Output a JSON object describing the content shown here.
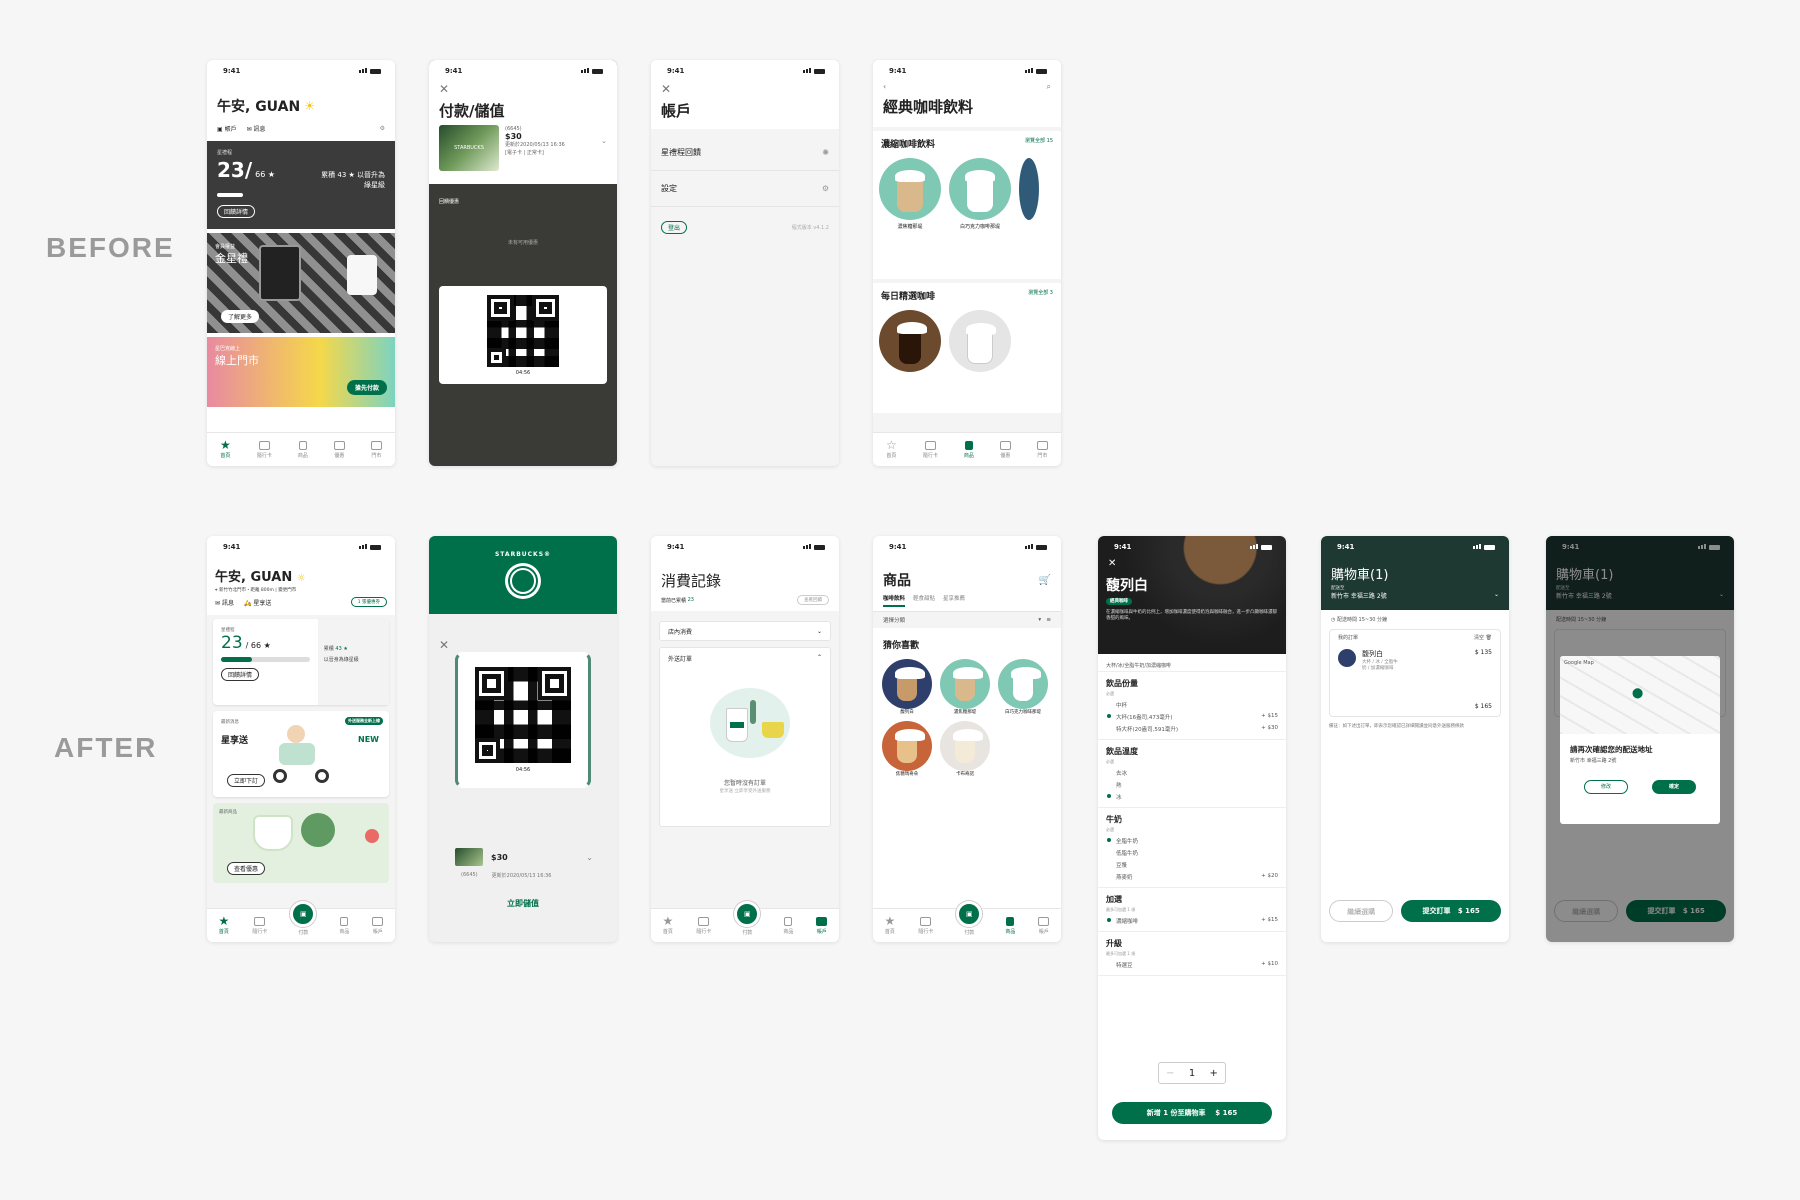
{
  "labels": {
    "before": "BEFORE",
    "after": "AFTER"
  },
  "status_time": "9:41",
  "before": {
    "home": {
      "greeting": "午安, GUAN",
      "links": [
        "帳戶",
        "訊息"
      ],
      "card_label": "星禮程",
      "stars_current": "23/",
      "stars_total": "66 ★",
      "stars_text": "累積 43 ★ 以晉升為",
      "stars_text2": "綠星級",
      "detail_btn": "回饋詳情",
      "promo1_tag": "會員權益",
      "promo1_title": "金星禮",
      "promo1_btn": "了解更多",
      "promo2_tag": "星巴克線上",
      "promo2_title": "線上門市",
      "promo2_btn": "搶先付款",
      "tabs": [
        "首頁",
        "隨行卡",
        "商品",
        "優惠",
        "門市"
      ]
    },
    "pay": {
      "title": "付款/儲值",
      "card_num": "(6645)",
      "balance": "$30",
      "updated": "更新於2020/05/13 16:36",
      "card_type": "[電子卡 | 正常卡]",
      "section": "回饋優惠",
      "empty": "未有可用優惠",
      "timer": "04:56"
    },
    "account": {
      "title": "帳戶",
      "rows": [
        "星禮程回饋",
        "設定"
      ],
      "logout": "登出",
      "version": "程式版本 v4.1.2"
    },
    "menu": {
      "title": "經典咖啡飲料",
      "sec1": "濃縮咖啡飲料",
      "sec1_more": "瀏覽全部 15",
      "items1": [
        "濃焦糖那堤",
        "白巧克力咖啡那堤"
      ],
      "sec2": "每日精選咖啡",
      "sec2_more": "瀏覽全部 3",
      "tabs": [
        "首頁",
        "隨行卡",
        "商品",
        "優惠",
        "門市"
      ]
    }
  },
  "after": {
    "home": {
      "greeting": "午安, GUAN",
      "location": "新竹竹北門市・距離 800m | 變更門市",
      "links": [
        "訊息",
        "星享送"
      ],
      "badge": "1 張優惠券",
      "card_label": "星禮程",
      "stars_current": "23",
      "stars_total": "/  66 ★",
      "stars_right1": "累積",
      "stars_right_num": "43 ★",
      "stars_right2": "以晉身為綠星級",
      "stars_progress": 0.35,
      "detail_btn": "回饋詳情",
      "promo1_tag": "最新消息",
      "promo1_title": "星享送",
      "promo1_badge": "外送服務全新上線",
      "promo1_new": "NEW",
      "promo1_btn": "立即下訂",
      "promo2_tag": "最新商品",
      "promo2_btn": "查看優惠",
      "tabs": [
        "首頁",
        "隨行卡",
        "付款",
        "商品",
        "帳戶"
      ]
    },
    "pay": {
      "brand": "STARBUCKS®",
      "timer": "04:56",
      "balance": "$30",
      "card_num": "(6645)",
      "updated": "更新於2020/05/13 16:36",
      "topup": "立即儲值"
    },
    "history": {
      "title": "消費記錄",
      "subtitle": "當前已累積",
      "sub_num": "23",
      "sub_btn": "查看回饋",
      "drop1": "店內消費",
      "drop2": "外送訂單",
      "empty": "您暫時沒有訂單",
      "empty_sub": "星享送 立即享受外送服務",
      "tabs": [
        "首頁",
        "隨行卡",
        "付款",
        "商品",
        "帳戶"
      ]
    },
    "products": {
      "title": "商品",
      "subtabs": [
        "咖啡飲料",
        "輕食甜點",
        "星享推薦"
      ],
      "filter": "選擇分類",
      "section": "猜你喜歡",
      "items": [
        "馥列白",
        "濃焦糖那堤",
        "白巧克力咖啡那堤",
        "焦糖瑪奇朵",
        "卡布奇諾"
      ],
      "tabs": [
        "首頁",
        "隨行卡",
        "付款",
        "商品",
        "帳戶"
      ]
    },
    "detail": {
      "name": "馥列白",
      "tag": "經典咖啡",
      "desc": "在濃縮咖啡與牛奶的比例上，增加咖啡濃度使得奶泡與咖啡融合，進一步凸顯咖啡濃郁香甜的風味。",
      "summary": "大杯/冰/全脂牛奶/加濃縮咖啡",
      "groups": [
        {
          "title": "飲品份量",
          "sub": "必選",
          "opts": [
            [
              "中杯",
              ""
            ],
            [
              "大杯(16盎司,473毫升)",
              "+ $15"
            ],
            [
              "特大杯(20盎司,591毫升)",
              "+ $30"
            ]
          ],
          "sel": 1
        },
        {
          "title": "飲品溫度",
          "sub": "必選",
          "opts": [
            [
              "去冰",
              ""
            ],
            [
              "熱",
              ""
            ],
            [
              "冰",
              ""
            ]
          ],
          "sel": 2
        },
        {
          "title": "牛奶",
          "sub": "必選",
          "opts": [
            [
              "全脂牛奶",
              ""
            ],
            [
              "低脂牛奶",
              ""
            ],
            [
              "豆漿",
              ""
            ],
            [
              "燕麥奶",
              "+ $20"
            ]
          ],
          "sel": 0
        },
        {
          "title": "加選",
          "sub": "最多可加選 1 項",
          "opts": [
            [
              "濃縮咖啡",
              "+ $15"
            ]
          ],
          "sel": 0
        },
        {
          "title": "升級",
          "sub": "最多可加選 1 項",
          "opts": [
            [
              "特選豆",
              "+ $10"
            ]
          ],
          "sel": -1
        }
      ],
      "qty": "1",
      "add_btn": "新增 1 份至購物車",
      "price": "$ 165"
    },
    "cart": {
      "title": "購物車(1)",
      "store_label": "配送至",
      "address": "新竹市 幸福三路 2號",
      "time": "配送時間 15~30 分鐘",
      "order_label": "我的訂單",
      "clear": "清空",
      "item": "馥列白",
      "item_opts": "大杯 / 冰 / 全脂牛奶 / 加濃縮咖啡",
      "item_price": "$ 135",
      "total": "$ 165",
      "note": "備註：如下述出訂單，即表示您確認已詳細閱讀並同意外送服務條款",
      "cont_btn": "繼續選購",
      "submit_btn": "提交訂單",
      "submit_price": "$ 165"
    },
    "confirm": {
      "map_label": "Google Map",
      "question": "請再次確認您的配送地址",
      "address": "新竹市 幸福三路 2號",
      "edit_btn": "修改",
      "ok_btn": "確定"
    }
  },
  "colors": {
    "brand": "#00704a",
    "dark": "#1e3932",
    "accent": "#f5c518"
  }
}
